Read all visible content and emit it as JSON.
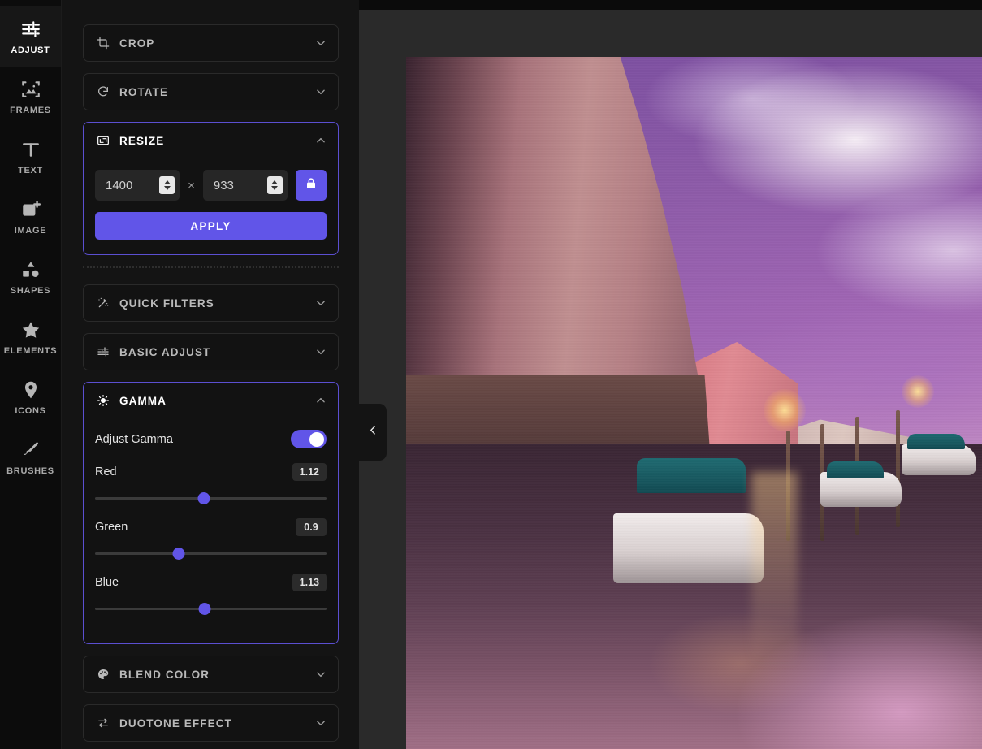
{
  "rail": {
    "items": [
      {
        "label": "ADJUST",
        "icon": "sliders-icon",
        "active": true
      },
      {
        "label": "FRAMES",
        "icon": "frame-image-icon",
        "active": false
      },
      {
        "label": "TEXT",
        "icon": "text-t-icon",
        "active": false
      },
      {
        "label": "IMAGE",
        "icon": "image-plus-icon",
        "active": false
      },
      {
        "label": "SHAPES",
        "icon": "shapes-icon",
        "active": false
      },
      {
        "label": "ELEMENTS",
        "icon": "star-icon",
        "active": false
      },
      {
        "label": "ICONS",
        "icon": "map-pin-icon",
        "active": false
      },
      {
        "label": "BRUSHES",
        "icon": "brush-icon",
        "active": false
      }
    ]
  },
  "panel": {
    "sections_top": [
      {
        "title": "CROP",
        "icon": "crop-icon",
        "open": false,
        "chevron": "chevron-down-icon"
      },
      {
        "title": "ROTATE",
        "icon": "rotate-icon",
        "open": false,
        "chevron": "chevron-down-icon"
      },
      {
        "title": "RESIZE",
        "icon": "resize-icon",
        "open": true,
        "chevron": "chevron-up-icon"
      }
    ],
    "resize": {
      "width_value": "1400",
      "height_value": "933",
      "width_placeholder": "Width",
      "height_placeholder": "Height",
      "separator": "×",
      "lock_icon": "lock-closed-icon",
      "lock_active": true,
      "apply_label": "APPLY"
    },
    "sections_bottom": [
      {
        "title": "QUICK FILTERS",
        "icon": "magic-wand-icon",
        "open": false,
        "chevron": "chevron-down-icon"
      },
      {
        "title": "BASIC ADJUST",
        "icon": "sliders-icon",
        "open": false,
        "chevron": "chevron-down-icon"
      },
      {
        "title": "GAMMA",
        "icon": "sun-icon",
        "open": true,
        "chevron": "chevron-up-icon"
      }
    ],
    "gamma": {
      "toggle_label": "Adjust Gamma",
      "toggle_on": true,
      "sliders": [
        {
          "name": "Red",
          "value": "1.12",
          "percent": 47
        },
        {
          "name": "Green",
          "value": "0.9",
          "percent": 36
        },
        {
          "name": "Blue",
          "value": "1.13",
          "percent": 47.5
        }
      ]
    },
    "sections_footer": [
      {
        "title": "BLEND COLOR",
        "icon": "palette-icon",
        "open": false,
        "chevron": "chevron-down-icon"
      },
      {
        "title": "DUOTONE EFFECT",
        "icon": "swap-arrows-icon",
        "open": false,
        "chevron": "chevron-down-icon"
      }
    ],
    "collapse_icon": "chevron-left-icon"
  },
  "colors": {
    "accent": "#6155e8",
    "accent_border": "#5b4fd1",
    "panel_bg": "#141414",
    "rail_bg": "#0c0c0c",
    "canvas_bg": "#2a2a2a"
  }
}
